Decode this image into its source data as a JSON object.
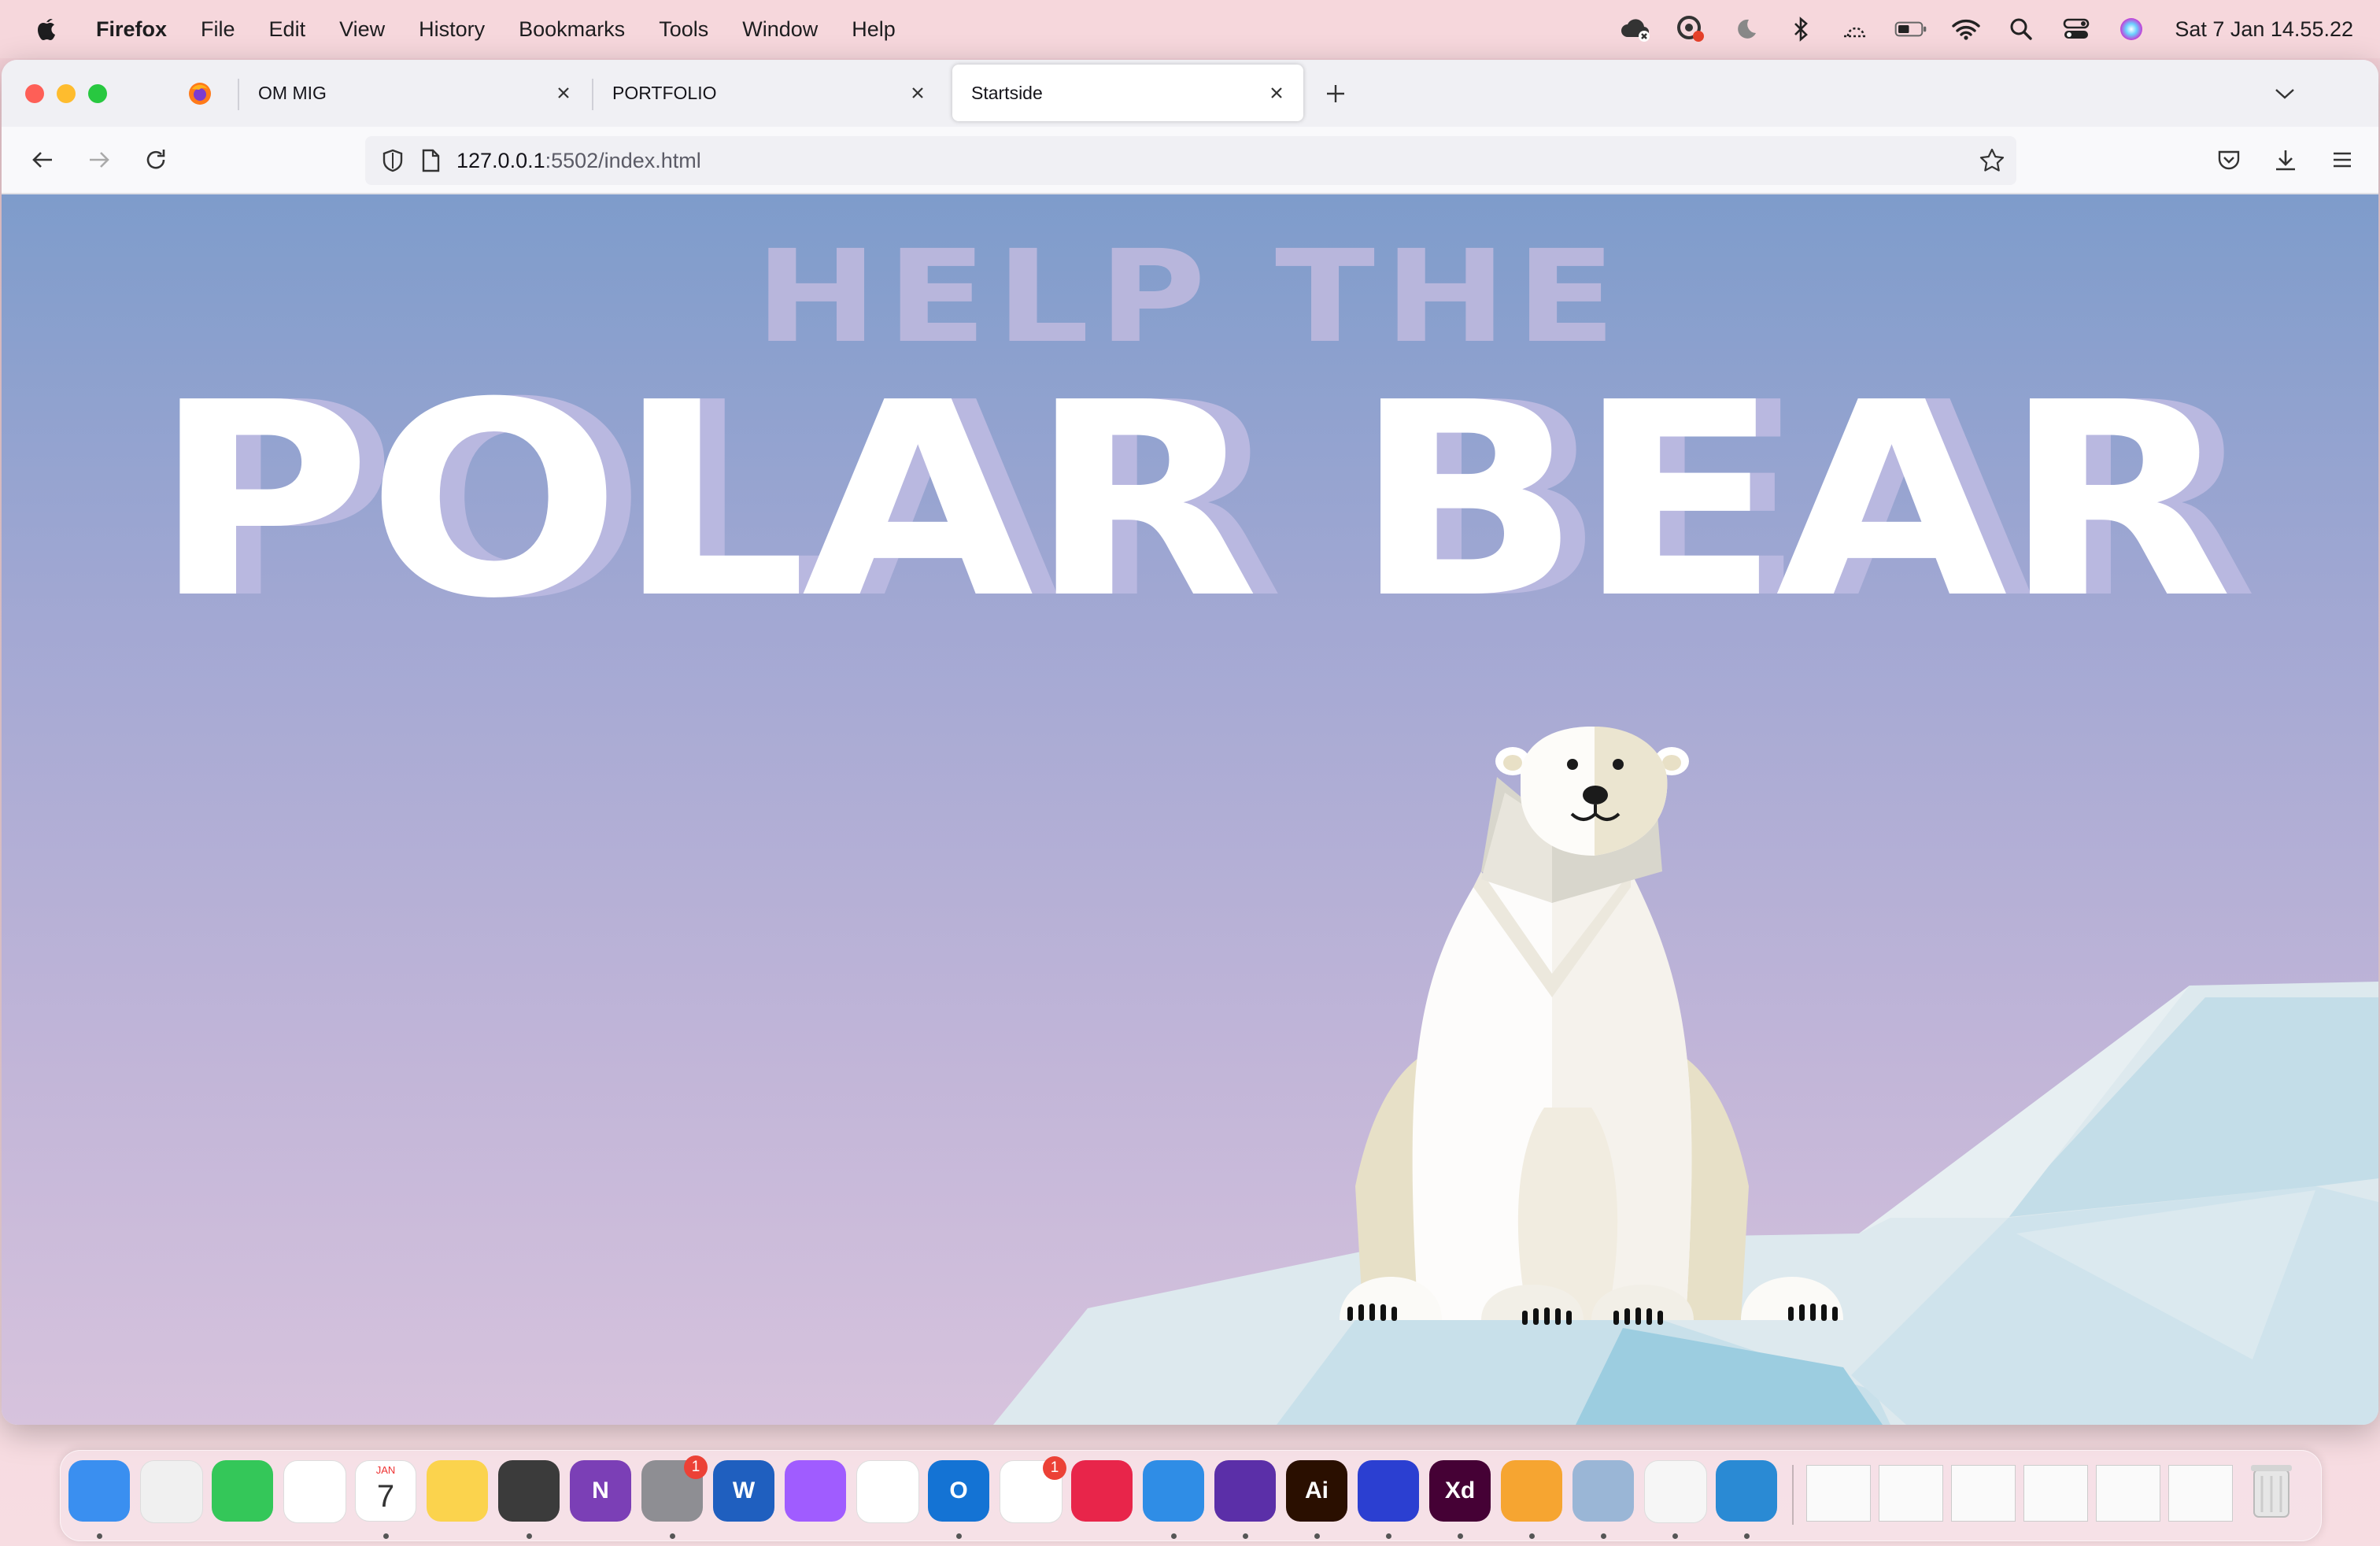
{
  "menubar": {
    "app_name": "Firefox",
    "items": [
      "File",
      "Edit",
      "View",
      "History",
      "Bookmarks",
      "Tools",
      "Window",
      "Help"
    ],
    "clock": "Sat 7 Jan  14.55.22",
    "status_icons": [
      "creative-cloud-icon",
      "adobe-sync-icon",
      "moon-icon",
      "bluetooth-icon",
      "cast-icon",
      "battery-icon",
      "wifi-icon",
      "search-icon",
      "control-center-icon",
      "siri-icon"
    ]
  },
  "browser": {
    "tabs": [
      {
        "label": "OM MIG",
        "active": false
      },
      {
        "label": "PORTFOLIO",
        "active": false
      },
      {
        "label": "Startside",
        "active": true
      }
    ],
    "url_host": "127.0.0.1",
    "url_path": ":5502/index.html"
  },
  "page": {
    "heading_small": "HELP THE",
    "heading_large": "POLAR BEAR",
    "colors": {
      "sky_top": "#7e9ccb",
      "sky_bottom": "#d7c3dd",
      "heading_small": "#b8b6dc",
      "heading_shadow": "#b9b8e0",
      "ice": "#cfe2ea"
    }
  },
  "dock": {
    "apps": [
      {
        "name": "finder-icon",
        "color": "#3a8ff0",
        "running": true
      },
      {
        "name": "launchpad-icon",
        "color": "#f0f0f0",
        "running": false
      },
      {
        "name": "messages-icon",
        "color": "#34c759",
        "running": false
      },
      {
        "name": "photos-icon",
        "color": "#ffffff",
        "running": false
      },
      {
        "name": "calendar-icon",
        "color": "#ffffff",
        "running": true,
        "text": "7",
        "sub": "JAN"
      },
      {
        "name": "notes-icon",
        "color": "#fbd34d",
        "running": false
      },
      {
        "name": "calculator-icon",
        "color": "#3b3b3b",
        "running": true
      },
      {
        "name": "onenote-icon",
        "color": "#7b3fb6",
        "running": false,
        "text": "N"
      },
      {
        "name": "system-settings-icon",
        "color": "#8e8e93",
        "running": true,
        "badge": "1"
      },
      {
        "name": "word-icon",
        "color": "#1f5fbf",
        "running": false,
        "text": "W"
      },
      {
        "name": "messenger-icon",
        "color": "#a05cff",
        "running": false
      },
      {
        "name": "chrome-icon",
        "color": "#ffffff",
        "running": false
      },
      {
        "name": "outlook-icon",
        "color": "#1473d4",
        "running": true,
        "text": "O"
      },
      {
        "name": "reminders-icon",
        "color": "#ffffff",
        "running": false,
        "badge": "1"
      },
      {
        "name": "creative-cloud-icon",
        "color": "#e8254a",
        "running": false
      },
      {
        "name": "safari-icon",
        "color": "#2f8de6",
        "running": true
      },
      {
        "name": "firefox-icon",
        "color": "#5b2fa8",
        "running": true
      },
      {
        "name": "illustrator-icon",
        "color": "#2a0f00",
        "running": true,
        "text": "Ai"
      },
      {
        "name": "audacity-icon",
        "color": "#2b3fd1",
        "running": true
      },
      {
        "name": "xd-icon",
        "color": "#450135",
        "running": true,
        "text": "Xd"
      },
      {
        "name": "pages-icon",
        "color": "#f6a531",
        "running": true
      },
      {
        "name": "preview-icon",
        "color": "#9ab6d6",
        "running": true
      },
      {
        "name": "textedit-icon",
        "color": "#f6f6f6",
        "running": true
      },
      {
        "name": "vscode-icon",
        "color": "#2a8ad4",
        "running": true
      }
    ],
    "thumbnails": 6
  }
}
